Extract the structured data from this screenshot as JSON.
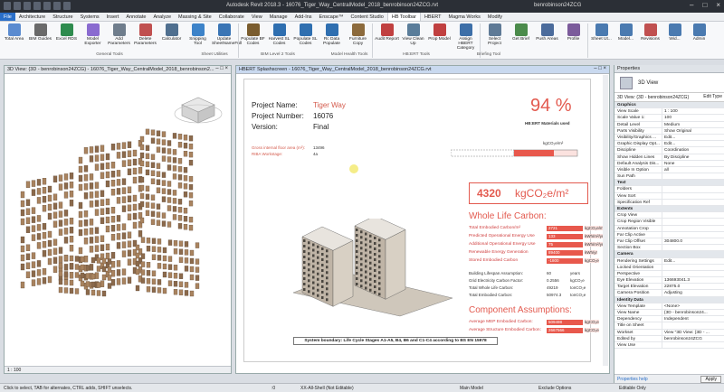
{
  "app": {
    "title": "Autodesk Revit 2018.3 -    16076_Tiger_Way_CentralModel_2018_benrobinson24ZCG.rvt",
    "user": "benrobinson24ZCG"
  },
  "tabs": [
    "File",
    "Architecture",
    "Structure",
    "Systems",
    "Insert",
    "Annotate",
    "Analyze",
    "Massing & Site",
    "Collaborate",
    "View",
    "Manage",
    "Add-Ins",
    "Enscape™",
    "Content Studio",
    "HB Toolbar",
    "HBERT",
    "Magma Works",
    "Modify"
  ],
  "ribbon": {
    "buttons": [
      {
        "label": "Total Area",
        "color": "#5b8bd0"
      },
      {
        "label": "BIM Guides",
        "color": "#6a6a6a"
      },
      {
        "label": "Excel RDS",
        "color": "#2e8b4e"
      },
      {
        "label": "Model Exporter",
        "color": "#8a6bd0"
      },
      {
        "label": "Add Parameters",
        "color": "#6f7d8c"
      },
      {
        "label": "Delete Parameters",
        "color": "#c05050"
      },
      {
        "label": "Calculator",
        "color": "#4f6f8f"
      },
      {
        "label": "Snipping Tool",
        "color": "#3d83c9"
      },
      {
        "label": "Update SheetNameFull",
        "color": "#3a75b5"
      },
      {
        "label": "Populate BF Codes",
        "color": "#7a5c2e"
      },
      {
        "label": "Harvest SL Codes",
        "color": "#2f6fb0"
      },
      {
        "label": "Populate SL Codes",
        "color": "#2f6fb0"
      },
      {
        "label": "Rc Data Populate",
        "color": "#2f6fb0"
      },
      {
        "label": "Furniture Copy",
        "color": "#8c6a3c"
      },
      {
        "label": "Audit Report",
        "color": "#c04040"
      },
      {
        "label": "View Clean Up",
        "color": "#5a7d9a"
      },
      {
        "label": "Prop Model",
        "color": "#c04040"
      },
      {
        "label": "Assign HBERT Category",
        "color": "#3d6fa8"
      },
      {
        "label": "Select Project",
        "color": "#5f7a96"
      },
      {
        "label": "Get Brief",
        "color": "#4b8b4b"
      },
      {
        "label": "Push Areas",
        "color": "#4b6b9b"
      },
      {
        "label": "Profile",
        "color": "#7b5b9b"
      },
      {
        "label": "Sheet Ut...",
        "color": "#4a7ab0"
      },
      {
        "label": "Model...",
        "color": "#4a7ab0"
      },
      {
        "label": "Revisions",
        "color": "#c05050"
      },
      {
        "label": "Wid...",
        "color": "#4a7ab0"
      },
      {
        "label": "Admin",
        "color": "#4a7ab0"
      }
    ],
    "groups": [
      "General Tools",
      "Sheet Utilities",
      "BIM Level 2 Tools",
      "Model Health Tools",
      "HB:ERT Tools",
      "Briefing Tool"
    ]
  },
  "view_left": {
    "title": "3D View: {3D - benrobinson24ZCG} - 16076_Tiger_Way_CentralModel_2018_benrobinson2...",
    "scale": "1 : 100"
  },
  "view_right": {
    "title": "HBERT Splashscreen - 16076_Tiger_Way_CentralModel_2018_benrobinson24ZCG.rvt"
  },
  "sheet": {
    "labels": {
      "project_name": "Project Name:",
      "project_number": "Project Number:",
      "version": "Version:"
    },
    "values": {
      "project_name": "Tiger Way",
      "project_number": "16076",
      "version": "Final"
    },
    "gia_label": "Gross internal floor area (m²):",
    "gia_value": "13496",
    "riba_label": "RIBA Workstage:",
    "riba_value": "4a",
    "percent": "94 %",
    "percent_caption": "HB:ERT Materials used",
    "gauge_unit": "kgCO₂e/m²",
    "headline_value": "4320",
    "headline_unit": "kgCO₂e/m²",
    "wlc_title": "Whole Life Carbon:",
    "wlc_rows": [
      {
        "label": "Total Embodied Carbon/m²",
        "value": "2721",
        "unit": "kgCO₂e/m²"
      },
      {
        "label": "Predicted Operational Energy Use",
        "value": "133",
        "unit": "kWh/m²/yr"
      },
      {
        "label": "Additional Operational Energy Use",
        "value": "75",
        "unit": "kWh/m²/yr"
      },
      {
        "label": "Renewable Energy Generation",
        "value": "89400",
        "unit": "kWh/yr"
      },
      {
        "label": "Stored Embodied Carbon",
        "value": "-1800",
        "unit": "kgCO₂e"
      }
    ],
    "plain_rows": [
      {
        "label": "Building Lifespan Assumption:",
        "value": "60",
        "unit": "years"
      },
      {
        "label": "Grid Electricity Carbon Factor:",
        "value": "0.2556",
        "unit": "kgCO₂e"
      },
      {
        "label": "Total Whole Life Carbon:",
        "value": "49219",
        "unit": "tonCO₂e"
      },
      {
        "label": "Total Embodied Carbon:",
        "value": "50974.3",
        "unit": "tonCO₂e"
      }
    ],
    "ca_title": "Component Assumptions:",
    "ca_rows": [
      {
        "label": "Average MEP Embodied Carbon:",
        "value": "509498",
        "unit": "kgCO₂e"
      },
      {
        "label": "Average Structure Embodied Carbon:",
        "value": "2667566",
        "unit": "kgCO₂e"
      }
    ],
    "system_boundary": "System boundary: Life Cycle Stages A1-A5, B4, B6 and C1-C4 according to BS EN 15978"
  },
  "properties": {
    "title": "Properties",
    "type": "3D View",
    "selector": "3D View: {3D - benrobinson24ZCG}",
    "edit_type": "Edit Type",
    "rows": [
      {
        "s": "Graphics"
      },
      {
        "k": "View Scale",
        "v": "1 : 100"
      },
      {
        "k": "Scale Value 1:",
        "v": "100"
      },
      {
        "k": "Detail Level",
        "v": "Medium"
      },
      {
        "k": "Parts Visibility",
        "v": "Show Original"
      },
      {
        "k": "Visibility/Graphics ...",
        "v": "Edit..."
      },
      {
        "k": "Graphic Display Opt...",
        "v": "Edit..."
      },
      {
        "k": "Discipline",
        "v": "Coordination"
      },
      {
        "k": "Show Hidden Lines",
        "v": "By Discipline"
      },
      {
        "k": "Default Analysis Dis...",
        "v": "None"
      },
      {
        "k": "Visible In Option",
        "v": "all"
      },
      {
        "k": "Sun Path",
        "v": ""
      },
      {
        "s": "Text"
      },
      {
        "k": "Folders",
        "v": ""
      },
      {
        "k": "View Sort",
        "v": ""
      },
      {
        "k": "Specification Ref",
        "v": ""
      },
      {
        "s": "Extents"
      },
      {
        "k": "Crop View",
        "v": ""
      },
      {
        "k": "Crop Region Visible",
        "v": ""
      },
      {
        "k": "Annotation Crop",
        "v": ""
      },
      {
        "k": "Far Clip Active",
        "v": ""
      },
      {
        "k": "Far Clip Offset",
        "v": "304800.0"
      },
      {
        "k": "Section Box",
        "v": ""
      },
      {
        "s": "Camera"
      },
      {
        "k": "Rendering Settings",
        "v": "Edit..."
      },
      {
        "k": "Locked Orientation",
        "v": ""
      },
      {
        "k": "Perspective",
        "v": ""
      },
      {
        "k": "Eye Elevation",
        "v": "136693041.3"
      },
      {
        "k": "Target Elevation",
        "v": "22875.0"
      },
      {
        "k": "Camera Position",
        "v": "Adjusting"
      },
      {
        "s": "Identity Data"
      },
      {
        "k": "View Template",
        "v": "<None>"
      },
      {
        "k": "View Name",
        "v": "{3D - benrobinson24..."
      },
      {
        "k": "Dependency",
        "v": "Independent"
      },
      {
        "k": "Title on Sheet",
        "v": ""
      },
      {
        "k": "Workset",
        "v": "View \"3D View: {3D - ..."
      },
      {
        "k": "Edited by",
        "v": "benrobinson24ZCG"
      },
      {
        "k": "View Use",
        "v": ""
      }
    ],
    "help": "Properties help",
    "apply": "Apply"
  },
  "statusbar": {
    "hint": "Click to select, TAB for alternates, CTRL adds, SHIFT unselects.",
    "workset": "XX-All-Shell (Not Editable)",
    "model": "Main Model",
    "exclude": "Exclude Options",
    "editable": "Editable Only",
    "zero": ":0"
  }
}
